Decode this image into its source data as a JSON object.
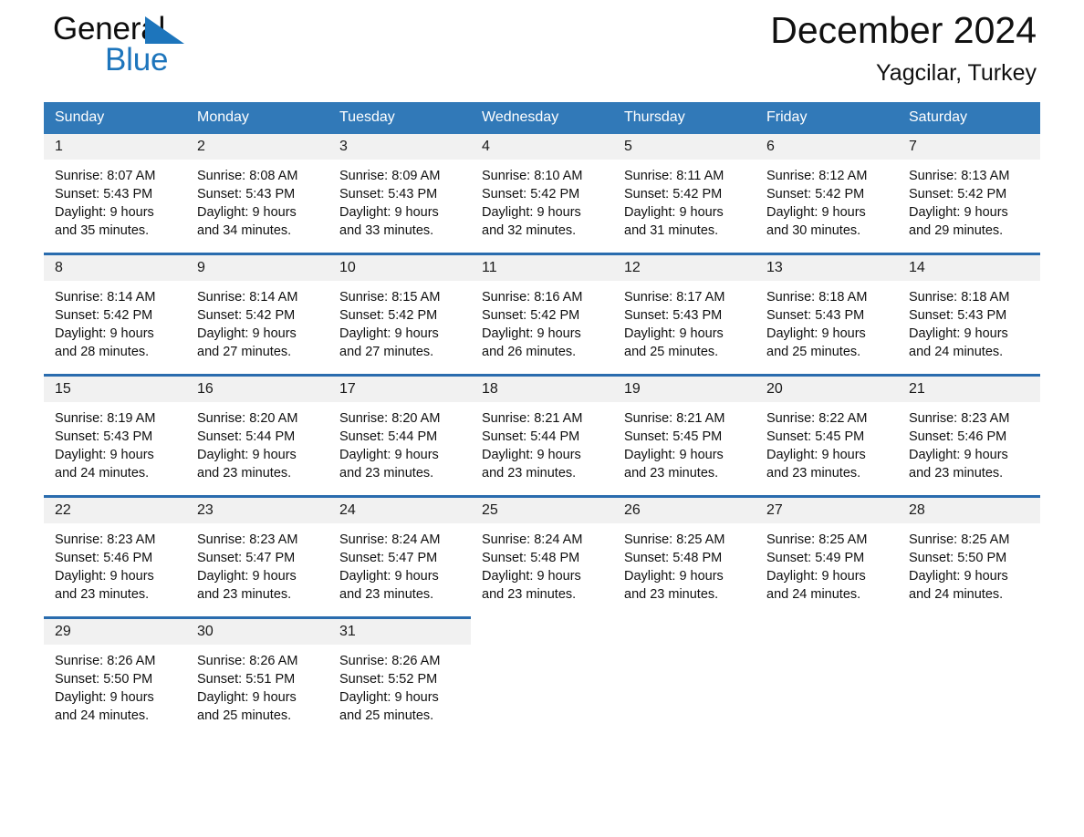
{
  "brand": {
    "name_dark": "General",
    "name_light": "Blue",
    "triangle_color": "#1d75bc",
    "icon": "triangle-logo-icon"
  },
  "header": {
    "title": "December 2024",
    "subtitle": "Yagcilar, Turkey"
  },
  "theme": {
    "header_blue": "#3179b8",
    "row_rule_blue": "#2a6cae",
    "daynum_band": "#f1f1f1",
    "text": "#101010"
  },
  "weekdays": [
    "Sunday",
    "Monday",
    "Tuesday",
    "Wednesday",
    "Thursday",
    "Friday",
    "Saturday"
  ],
  "weeks": [
    {
      "days": [
        {
          "date": "1",
          "sunrise": "Sunrise: 8:07 AM",
          "sunset": "Sunset: 5:43 PM",
          "daylight1": "Daylight: 9 hours",
          "daylight2": "and 35 minutes."
        },
        {
          "date": "2",
          "sunrise": "Sunrise: 8:08 AM",
          "sunset": "Sunset: 5:43 PM",
          "daylight1": "Daylight: 9 hours",
          "daylight2": "and 34 minutes."
        },
        {
          "date": "3",
          "sunrise": "Sunrise: 8:09 AM",
          "sunset": "Sunset: 5:43 PM",
          "daylight1": "Daylight: 9 hours",
          "daylight2": "and 33 minutes."
        },
        {
          "date": "4",
          "sunrise": "Sunrise: 8:10 AM",
          "sunset": "Sunset: 5:42 PM",
          "daylight1": "Daylight: 9 hours",
          "daylight2": "and 32 minutes."
        },
        {
          "date": "5",
          "sunrise": "Sunrise: 8:11 AM",
          "sunset": "Sunset: 5:42 PM",
          "daylight1": "Daylight: 9 hours",
          "daylight2": "and 31 minutes."
        },
        {
          "date": "6",
          "sunrise": "Sunrise: 8:12 AM",
          "sunset": "Sunset: 5:42 PM",
          "daylight1": "Daylight: 9 hours",
          "daylight2": "and 30 minutes."
        },
        {
          "date": "7",
          "sunrise": "Sunrise: 8:13 AM",
          "sunset": "Sunset: 5:42 PM",
          "daylight1": "Daylight: 9 hours",
          "daylight2": "and 29 minutes."
        }
      ]
    },
    {
      "days": [
        {
          "date": "8",
          "sunrise": "Sunrise: 8:14 AM",
          "sunset": "Sunset: 5:42 PM",
          "daylight1": "Daylight: 9 hours",
          "daylight2": "and 28 minutes."
        },
        {
          "date": "9",
          "sunrise": "Sunrise: 8:14 AM",
          "sunset": "Sunset: 5:42 PM",
          "daylight1": "Daylight: 9 hours",
          "daylight2": "and 27 minutes."
        },
        {
          "date": "10",
          "sunrise": "Sunrise: 8:15 AM",
          "sunset": "Sunset: 5:42 PM",
          "daylight1": "Daylight: 9 hours",
          "daylight2": "and 27 minutes."
        },
        {
          "date": "11",
          "sunrise": "Sunrise: 8:16 AM",
          "sunset": "Sunset: 5:42 PM",
          "daylight1": "Daylight: 9 hours",
          "daylight2": "and 26 minutes."
        },
        {
          "date": "12",
          "sunrise": "Sunrise: 8:17 AM",
          "sunset": "Sunset: 5:43 PM",
          "daylight1": "Daylight: 9 hours",
          "daylight2": "and 25 minutes."
        },
        {
          "date": "13",
          "sunrise": "Sunrise: 8:18 AM",
          "sunset": "Sunset: 5:43 PM",
          "daylight1": "Daylight: 9 hours",
          "daylight2": "and 25 minutes."
        },
        {
          "date": "14",
          "sunrise": "Sunrise: 8:18 AM",
          "sunset": "Sunset: 5:43 PM",
          "daylight1": "Daylight: 9 hours",
          "daylight2": "and 24 minutes."
        }
      ]
    },
    {
      "days": [
        {
          "date": "15",
          "sunrise": "Sunrise: 8:19 AM",
          "sunset": "Sunset: 5:43 PM",
          "daylight1": "Daylight: 9 hours",
          "daylight2": "and 24 minutes."
        },
        {
          "date": "16",
          "sunrise": "Sunrise: 8:20 AM",
          "sunset": "Sunset: 5:44 PM",
          "daylight1": "Daylight: 9 hours",
          "daylight2": "and 23 minutes."
        },
        {
          "date": "17",
          "sunrise": "Sunrise: 8:20 AM",
          "sunset": "Sunset: 5:44 PM",
          "daylight1": "Daylight: 9 hours",
          "daylight2": "and 23 minutes."
        },
        {
          "date": "18",
          "sunrise": "Sunrise: 8:21 AM",
          "sunset": "Sunset: 5:44 PM",
          "daylight1": "Daylight: 9 hours",
          "daylight2": "and 23 minutes."
        },
        {
          "date": "19",
          "sunrise": "Sunrise: 8:21 AM",
          "sunset": "Sunset: 5:45 PM",
          "daylight1": "Daylight: 9 hours",
          "daylight2": "and 23 minutes."
        },
        {
          "date": "20",
          "sunrise": "Sunrise: 8:22 AM",
          "sunset": "Sunset: 5:45 PM",
          "daylight1": "Daylight: 9 hours",
          "daylight2": "and 23 minutes."
        },
        {
          "date": "21",
          "sunrise": "Sunrise: 8:23 AM",
          "sunset": "Sunset: 5:46 PM",
          "daylight1": "Daylight: 9 hours",
          "daylight2": "and 23 minutes."
        }
      ]
    },
    {
      "days": [
        {
          "date": "22",
          "sunrise": "Sunrise: 8:23 AM",
          "sunset": "Sunset: 5:46 PM",
          "daylight1": "Daylight: 9 hours",
          "daylight2": "and 23 minutes."
        },
        {
          "date": "23",
          "sunrise": "Sunrise: 8:23 AM",
          "sunset": "Sunset: 5:47 PM",
          "daylight1": "Daylight: 9 hours",
          "daylight2": "and 23 minutes."
        },
        {
          "date": "24",
          "sunrise": "Sunrise: 8:24 AM",
          "sunset": "Sunset: 5:47 PM",
          "daylight1": "Daylight: 9 hours",
          "daylight2": "and 23 minutes."
        },
        {
          "date": "25",
          "sunrise": "Sunrise: 8:24 AM",
          "sunset": "Sunset: 5:48 PM",
          "daylight1": "Daylight: 9 hours",
          "daylight2": "and 23 minutes."
        },
        {
          "date": "26",
          "sunrise": "Sunrise: 8:25 AM",
          "sunset": "Sunset: 5:48 PM",
          "daylight1": "Daylight: 9 hours",
          "daylight2": "and 23 minutes."
        },
        {
          "date": "27",
          "sunrise": "Sunrise: 8:25 AM",
          "sunset": "Sunset: 5:49 PM",
          "daylight1": "Daylight: 9 hours",
          "daylight2": "and 24 minutes."
        },
        {
          "date": "28",
          "sunrise": "Sunrise: 8:25 AM",
          "sunset": "Sunset: 5:50 PM",
          "daylight1": "Daylight: 9 hours",
          "daylight2": "and 24 minutes."
        }
      ]
    },
    {
      "days": [
        {
          "date": "29",
          "sunrise": "Sunrise: 8:26 AM",
          "sunset": "Sunset: 5:50 PM",
          "daylight1": "Daylight: 9 hours",
          "daylight2": "and 24 minutes."
        },
        {
          "date": "30",
          "sunrise": "Sunrise: 8:26 AM",
          "sunset": "Sunset: 5:51 PM",
          "daylight1": "Daylight: 9 hours",
          "daylight2": "and 25 minutes."
        },
        {
          "date": "31",
          "sunrise": "Sunrise: 8:26 AM",
          "sunset": "Sunset: 5:52 PM",
          "daylight1": "Daylight: 9 hours",
          "daylight2": "and 25 minutes."
        },
        {
          "date": "",
          "sunrise": "",
          "sunset": "",
          "daylight1": "",
          "daylight2": ""
        },
        {
          "date": "",
          "sunrise": "",
          "sunset": "",
          "daylight1": "",
          "daylight2": ""
        },
        {
          "date": "",
          "sunrise": "",
          "sunset": "",
          "daylight1": "",
          "daylight2": ""
        },
        {
          "date": "",
          "sunrise": "",
          "sunset": "",
          "daylight1": "",
          "daylight2": ""
        }
      ]
    }
  ]
}
